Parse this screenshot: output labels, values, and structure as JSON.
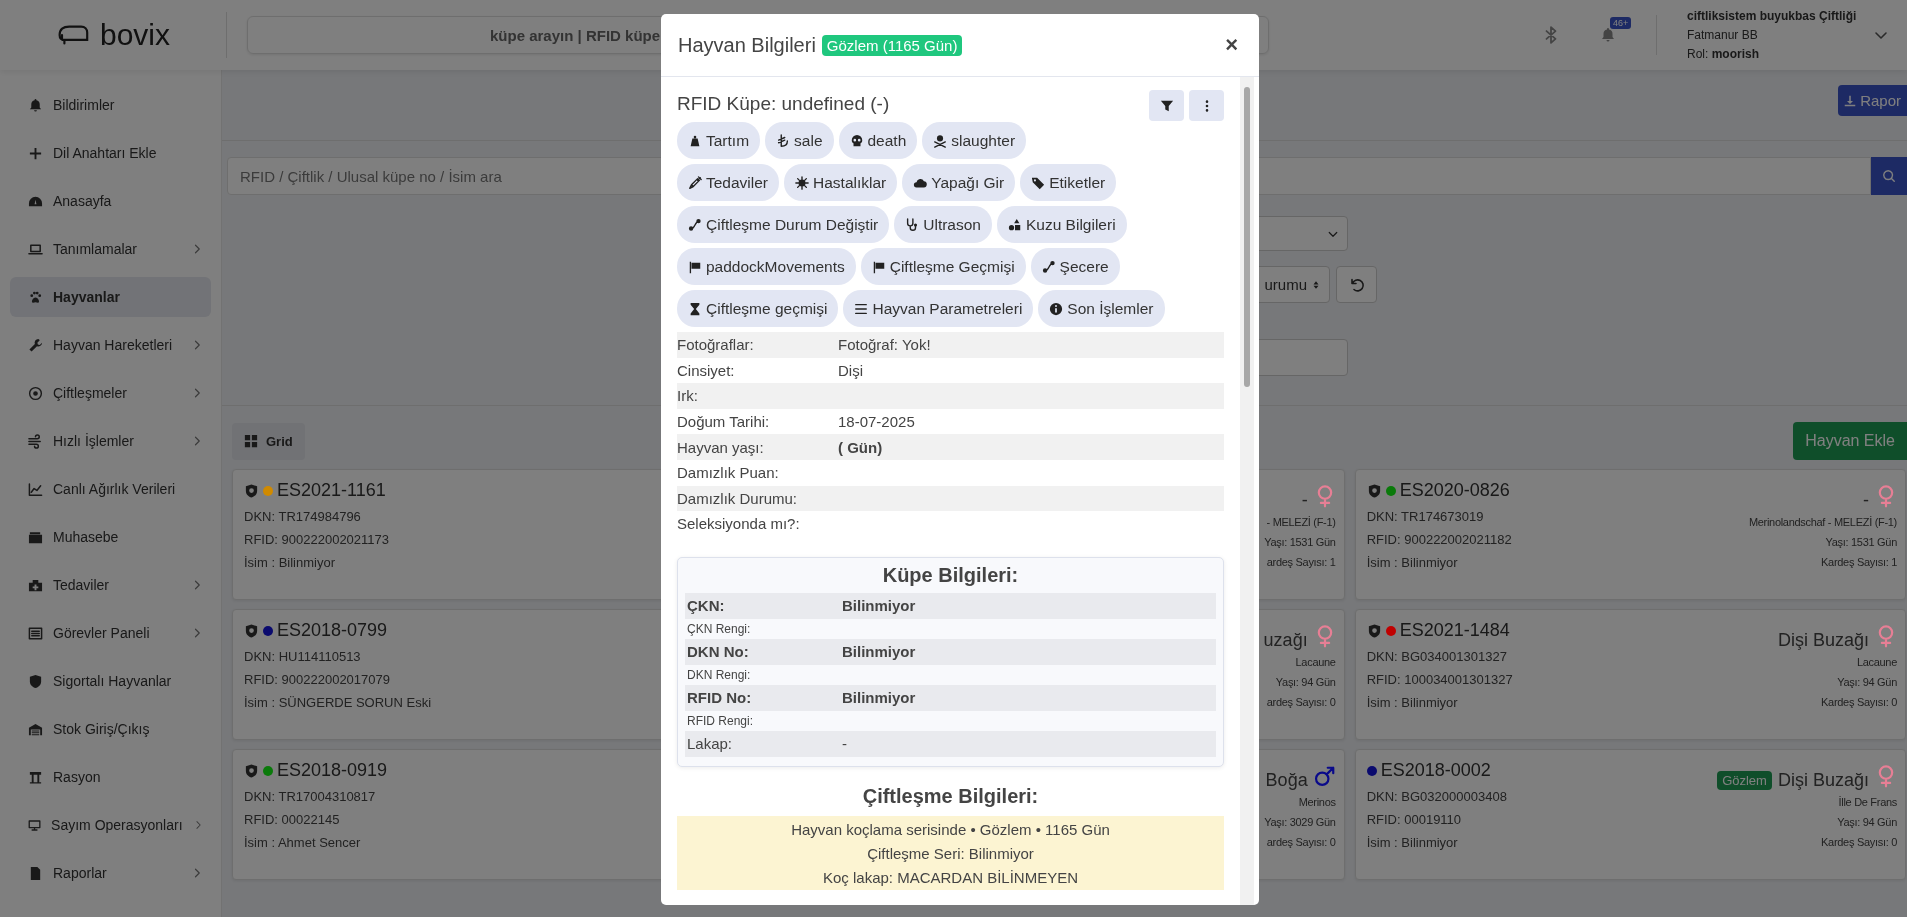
{
  "header": {
    "logo": "bovix",
    "search_text": "küpe arayın | RFID küpe",
    "notification_count": "46+",
    "farm": "ciftliksistem buyukbas Çiftliği",
    "user": "Fatmanur BB",
    "role_label": "Rol:",
    "role": "moorish"
  },
  "sidebar": {
    "items": [
      {
        "label": "Bildirimler",
        "expandable": false,
        "selected": false
      },
      {
        "label": "Dil Anahtarı Ekle",
        "expandable": false,
        "selected": false
      },
      {
        "label": "Anasayfa",
        "expandable": false,
        "selected": false
      },
      {
        "label": "Tanımlamalar",
        "expandable": true,
        "selected": false
      },
      {
        "label": "Hayvanlar",
        "expandable": false,
        "selected": true
      },
      {
        "label": "Hayvan Hareketleri",
        "expandable": true,
        "selected": false
      },
      {
        "label": "Çiftleşmeler",
        "expandable": true,
        "selected": false
      },
      {
        "label": "Hızlı İşlemler",
        "expandable": true,
        "selected": false
      },
      {
        "label": "Canlı Ağırlık Verileri",
        "expandable": false,
        "selected": false
      },
      {
        "label": "Muhasebe",
        "expandable": false,
        "selected": false
      },
      {
        "label": "Tedaviler",
        "expandable": true,
        "selected": false
      },
      {
        "label": "Görevler Paneli",
        "expandable": true,
        "selected": false
      },
      {
        "label": "Sigortalı Hayvanlar",
        "expandable": false,
        "selected": false
      },
      {
        "label": "Stok Giriş/Çıkış",
        "expandable": false,
        "selected": false
      },
      {
        "label": "Rasyon",
        "expandable": false,
        "selected": false
      },
      {
        "label": "Sayım Operasyonları",
        "expandable": true,
        "selected": false
      },
      {
        "label": "Raporlar",
        "expandable": true,
        "selected": false
      }
    ]
  },
  "toolbar": {
    "report_button": "Rapor",
    "search_placeholder": "RFID / Çiftlik / Ulusal küpe no / İsim ara",
    "sort_button": "urumu",
    "view_button": "Grid",
    "add_button": "Hayvan Ekle"
  },
  "animal_cards": [
    {
      "insured": true,
      "color": "#d08a00",
      "tag": "ES2021-1161",
      "dkn": "DKN: TR174984796",
      "rfid": "RFID: 900222002021173",
      "name": "İsim : Bilinmiyor"
    },
    {
      "title": "-",
      "male": false,
      "breed": "- MELEZİ (F-1)",
      "age": "Yaşı: 1531 Gün",
      "siblings": "ardeş Sayısı: 1"
    },
    {
      "insured": true,
      "color": "#0a7a0a",
      "tag": "ES2020-0826",
      "dkn": "DKN: TR174673019",
      "rfid": "RFID: 900222002021182",
      "name": "İsim : Bilinmiyor",
      "title": "-",
      "male": false,
      "breed": "Merinolandschaf - MELEZİ (F-1)",
      "age": "Yaşı: 1531 Gün",
      "siblings": "Kardeş Sayısı: 1"
    },
    {
      "insured": true,
      "color": "#0a0a6e",
      "tag": "ES2018-0799",
      "dkn": "DKN: HU114110513",
      "rfid": "RFID: 900222002017079",
      "name": "İsim : SÜNGERDE SORUN Eski"
    },
    {
      "title": "uzağı",
      "male": false,
      "breed": "Lacaune",
      "age": "Yaşı: 94 Gün",
      "siblings": "ardeş Sayısı: 0"
    },
    {
      "insured": true,
      "color": "#c00000",
      "tag": "ES2021-1484",
      "dkn": "DKN: BG034001301327",
      "rfid": "RFID: 100034001301327",
      "name": "İsim : Bilinmiyor",
      "title": "Dişi Buzağı",
      "male": false,
      "breed": "Lacaune",
      "age": "Yaşı: 94 Gün",
      "siblings": "Kardeş Sayısı: 0"
    },
    {
      "insured": true,
      "color": "#0a7a0a",
      "tag": "ES2018-0919",
      "dkn": "DKN: TR17004310817",
      "rfid": "RFID: 00022145",
      "name": "İsim : Ahmet Sencer"
    },
    {
      "title": "Boğa",
      "male": true,
      "breed": "Merinos",
      "age": "Yaşı: 3029 Gün",
      "siblings": "ardeş Sayısı: 0"
    },
    {
      "insured": false,
      "color": "#0a0a6e",
      "tag": "ES2018-0002",
      "dkn": "DKN: BG032000003408",
      "rfid": "RFID: 00019110",
      "name": "İsim : Bilinmiyor",
      "badge": "Gözlem",
      "title": "Dişi Buzağı",
      "male": false,
      "breed": "İlle De Frans",
      "age": "Yaşı: 94 Gün",
      "siblings": "Kardeş Sayısı: 0"
    }
  ],
  "modal": {
    "title": "Hayvan Bilgileri",
    "status_badge": "Gözlem (1165 Gün)",
    "close": "×",
    "rfid_heading": "RFID Küpe: undefined (-)",
    "action_rows": [
      [
        "Tartım",
        "sale",
        "death",
        "slaughter"
      ],
      [
        "Tedaviler",
        "Hastalıklar",
        "Yapağı Gir",
        "Etiketler"
      ],
      [
        "Çiftleşme Durum Değiştir",
        "Ultrason",
        "Kuzu Bilgileri"
      ],
      [
        "paddockMovements",
        "Çiftleşme Geçmişi",
        "Şecere"
      ],
      [
        "Çiftleşme geçmişi",
        "Hayvan Parametreleri",
        "Son İşlemler"
      ]
    ],
    "details": [
      {
        "label": "Fotoğraflar:",
        "value": "Fotoğraf: Yok!",
        "strong": false
      },
      {
        "label": "Cinsiyet:",
        "value": "Dişi",
        "strong": false
      },
      {
        "label": "Irk:"
      },
      {
        "label": "Doğum Tarihi:",
        "value": "18-07-2025",
        "strong": false
      },
      {
        "label": "Hayvan yaşı:",
        "value": "( Gün)",
        "strong": true
      },
      {
        "label": "Damızlık Puan:"
      },
      {
        "label": "Damızlık Durumu:"
      },
      {
        "label": "Seleksiyonda mı?:"
      }
    ],
    "tag_info": {
      "title": "Küpe Bilgileri:",
      "rows": [
        {
          "kind": "head",
          "label": "ÇKN:",
          "value": "Bilinmiyor"
        },
        {
          "kind": "sub",
          "label": "ÇKN Rengi:"
        },
        {
          "kind": "head",
          "label": "DKN No:",
          "value": "Bilinmiyor"
        },
        {
          "kind": "sub",
          "label": "DKN Rengi:"
        },
        {
          "kind": "head",
          "label": "RFID No:",
          "value": "Bilinmiyor"
        },
        {
          "kind": "sub",
          "label": "RFID Rengi:"
        },
        {
          "kind": "plain",
          "label": "Lakap:",
          "value": "-"
        }
      ]
    },
    "mating_info": {
      "title": "Çiftleşme Bilgileri:",
      "lines": [
        "Hayvan koçlama serisinde • Gözlem • 1165 Gün",
        "Çiftleşme Seri: Bilinmiyor",
        "Koç lakap: MACARDAN BİLİNMEYEN"
      ]
    }
  }
}
